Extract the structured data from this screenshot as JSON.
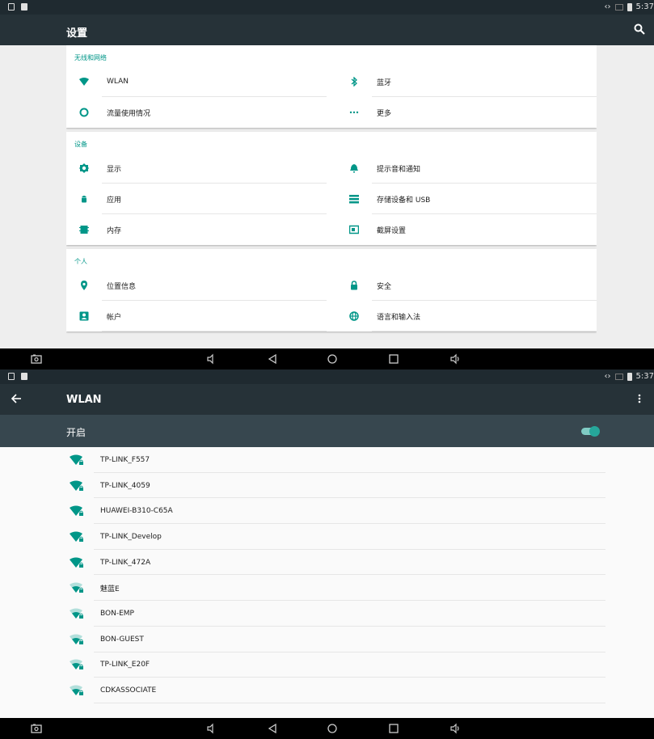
{
  "status_bar": {
    "time": "5:37"
  },
  "settings_screen": {
    "title": "设置",
    "sections": [
      {
        "header": "无线和网络",
        "items": [
          {
            "label": "WLAN",
            "icon": "wifi-icon"
          },
          {
            "label": "蓝牙",
            "icon": "bluetooth-icon"
          },
          {
            "label": "流量使用情况",
            "icon": "data-usage-icon"
          },
          {
            "label": "更多",
            "icon": "more-icon"
          }
        ]
      },
      {
        "header": "设备",
        "items": [
          {
            "label": "显示",
            "icon": "brightness-icon"
          },
          {
            "label": "提示音和通知",
            "icon": "bell-icon"
          },
          {
            "label": "应用",
            "icon": "android-icon"
          },
          {
            "label": "存储设备和 USB",
            "icon": "storage-icon"
          },
          {
            "label": "内存",
            "icon": "memory-icon"
          },
          {
            "label": "截屏设置",
            "icon": "screenshot-icon"
          }
        ]
      },
      {
        "header": "个人",
        "items": [
          {
            "label": "位置信息",
            "icon": "location-icon"
          },
          {
            "label": "安全",
            "icon": "lock-icon"
          },
          {
            "label": "帐户",
            "icon": "account-icon"
          },
          {
            "label": "语言和输入法",
            "icon": "globe-icon"
          }
        ]
      }
    ]
  },
  "wlan_screen": {
    "title": "WLAN",
    "toggle_label": "开启",
    "toggle_on": true,
    "networks": [
      {
        "ssid": "TP-LINK_F557",
        "secured": true,
        "strength": "full"
      },
      {
        "ssid": "TP-LINK_4059",
        "secured": true,
        "strength": "full"
      },
      {
        "ssid": "HUAWEI-B310-C65A",
        "secured": true,
        "strength": "full"
      },
      {
        "ssid": "TP-LINK_Develop",
        "secured": true,
        "strength": "full"
      },
      {
        "ssid": "TP-LINK_472A",
        "secured": true,
        "strength": "full"
      },
      {
        "ssid": "魅蓝E",
        "secured": true,
        "strength": "medium"
      },
      {
        "ssid": "BON-EMP",
        "secured": true,
        "strength": "medium"
      },
      {
        "ssid": "BON-GUEST",
        "secured": true,
        "strength": "medium"
      },
      {
        "ssid": "TP-LINK_E20F",
        "secured": true,
        "strength": "medium"
      },
      {
        "ssid": "CDKASSOCIATE",
        "secured": true,
        "strength": "medium"
      }
    ]
  },
  "colors": {
    "appbar": "#263238",
    "subbar": "#37474f",
    "accent": "#009688",
    "statusbar": "#1f2a30",
    "navbar": "#000000"
  }
}
